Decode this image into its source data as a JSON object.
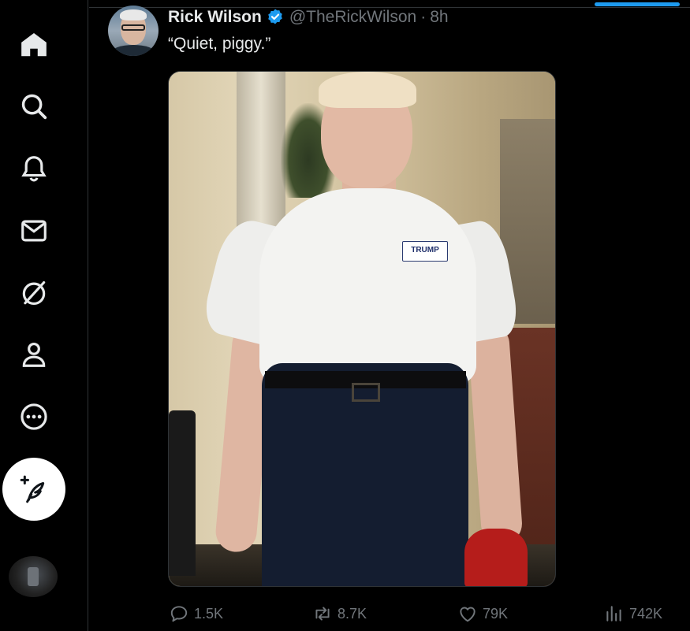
{
  "nav": {
    "items": [
      {
        "name": "home",
        "icon": "home-icon"
      },
      {
        "name": "explore",
        "icon": "search-icon"
      },
      {
        "name": "notifications",
        "icon": "bell-icon"
      },
      {
        "name": "messages",
        "icon": "envelope-icon"
      },
      {
        "name": "grok",
        "icon": "grok-icon"
      },
      {
        "name": "profile",
        "icon": "person-icon"
      },
      {
        "name": "more",
        "icon": "more-circle-icon"
      }
    ],
    "compose_icon": "compose-feather-icon"
  },
  "tweet": {
    "author_name": "Rick Wilson",
    "handle": "@TheRickWilson",
    "separator": "·",
    "time": "8h",
    "verified": true,
    "text": "“Quiet, piggy.”",
    "media_logo_text": "TRUMP"
  },
  "actions": {
    "replies": "1.5K",
    "reposts": "8.7K",
    "likes": "79K",
    "views": "742K"
  },
  "colors": {
    "background": "#000000",
    "text_primary": "#e7e9ea",
    "text_secondary": "#71767b",
    "accent": "#1d9bf0",
    "border": "#2f3336"
  }
}
